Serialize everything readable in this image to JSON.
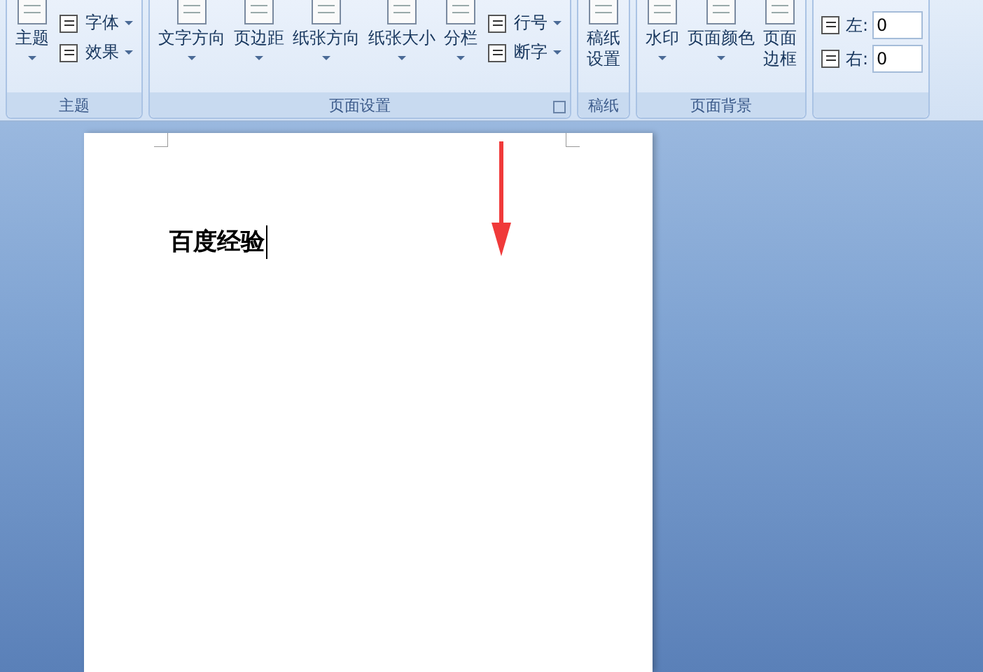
{
  "ribbon": {
    "groups": [
      {
        "label": "主题",
        "launcher": false,
        "buttons": [
          {
            "kind": "large",
            "lines": [
              "主题"
            ],
            "dropdown": true
          },
          {
            "kind": "stack",
            "items": [
              {
                "label": "字体",
                "dropdown": true
              },
              {
                "label": "效果",
                "dropdown": true
              }
            ]
          }
        ]
      },
      {
        "label": "页面设置",
        "launcher": true,
        "buttons": [
          {
            "kind": "large",
            "lines": [
              "文字方向"
            ],
            "dropdown": true
          },
          {
            "kind": "large",
            "lines": [
              "页边距"
            ],
            "dropdown": true
          },
          {
            "kind": "large",
            "lines": [
              "纸张方向"
            ],
            "dropdown": true
          },
          {
            "kind": "large",
            "lines": [
              "纸张大小"
            ],
            "dropdown": true
          },
          {
            "kind": "large",
            "lines": [
              "分栏"
            ],
            "dropdown": true
          },
          {
            "kind": "stack",
            "items": [
              {
                "label": "行号",
                "dropdown": true
              },
              {
                "label": "断字",
                "dropdown": true
              }
            ]
          }
        ]
      },
      {
        "label": "稿纸",
        "launcher": false,
        "buttons": [
          {
            "kind": "large",
            "lines": [
              "稿纸",
              "设置"
            ],
            "dropdown": false
          }
        ]
      },
      {
        "label": "页面背景",
        "launcher": false,
        "buttons": [
          {
            "kind": "large",
            "lines": [
              "水印"
            ],
            "dropdown": true
          },
          {
            "kind": "large",
            "lines": [
              "页面颜色"
            ],
            "dropdown": true
          },
          {
            "kind": "large",
            "lines": [
              "页面",
              "边框"
            ],
            "dropdown": false
          }
        ]
      },
      {
        "launcher": false,
        "buttons": [
          {
            "kind": "fields",
            "items": [
              {
                "label": "左:",
                "value": "0"
              },
              {
                "label": "右:",
                "value": "0"
              }
            ]
          }
        ]
      }
    ]
  },
  "document": {
    "text": "百度经验",
    "cursor": true
  }
}
